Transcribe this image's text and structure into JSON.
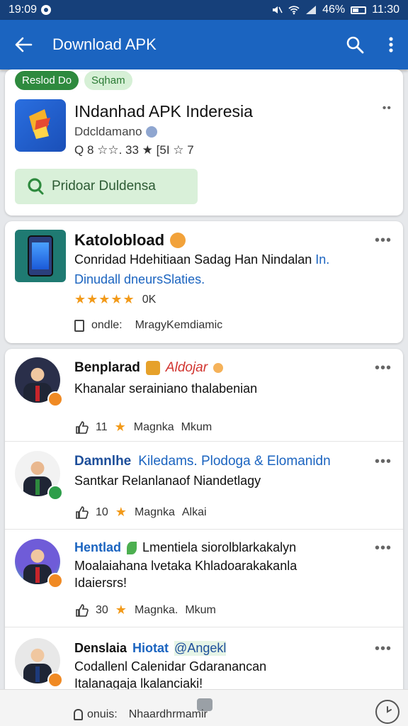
{
  "status": {
    "time_left": "19:09",
    "battery": "46%",
    "time_right": "11:30"
  },
  "appbar": {
    "title": "Download APK"
  },
  "top_card": {
    "chips": [
      "Reslod Do",
      "Sqham"
    ],
    "app_name": "INdanhad APK Inderesia",
    "developer": "Ddcldamano",
    "meta": "Q 8 ☆☆. 33 ★ [5I ☆ 7",
    "button_label": "Pridoar Duldensa"
  },
  "featured_card": {
    "title": "Katolobload",
    "line1": "Conridad Hdehitiaan Sadag Han Nindalan",
    "line1_link": "In.",
    "line2": "Dinudall dneursSlaties.",
    "rating": "★★★★★",
    "rating_count": "0K",
    "footer_prefix": "ondle:",
    "footer_value": "MragyKemdiamic"
  },
  "reviews": [
    {
      "name": "Benplarad",
      "tag": "Aldojar",
      "text": "Khanalar serainiano  thalabenian",
      "likes": "11",
      "cat": "Magnka",
      "author": "Mkum"
    },
    {
      "name": "Damnlhe",
      "tag": "Kiledams. Plodoga & Elomanidn",
      "text": "Santkar Relanlanaof Niandetlagy",
      "likes": "10",
      "cat": "Magnka",
      "author": "Alkai"
    },
    {
      "name": "Hentlad",
      "tag": "Lmentiela siorolblarkakalyn",
      "text": "Moalaiahana lvetaka Khladoarakakanla",
      "text2": "Idaiersrs!",
      "likes": "30",
      "cat": "Magnka.",
      "author": "Mkum"
    },
    {
      "name": "Denslaia",
      "tag": "Hiotat",
      "tag2": "@Angekl",
      "text": "Codallenl Calenidar Gdaranancan",
      "text2": "Italanagaja lkalanciaki!"
    }
  ],
  "bottombar": {
    "label_prefix": "onuis:",
    "label_value": "Nhaardhrmamir"
  }
}
